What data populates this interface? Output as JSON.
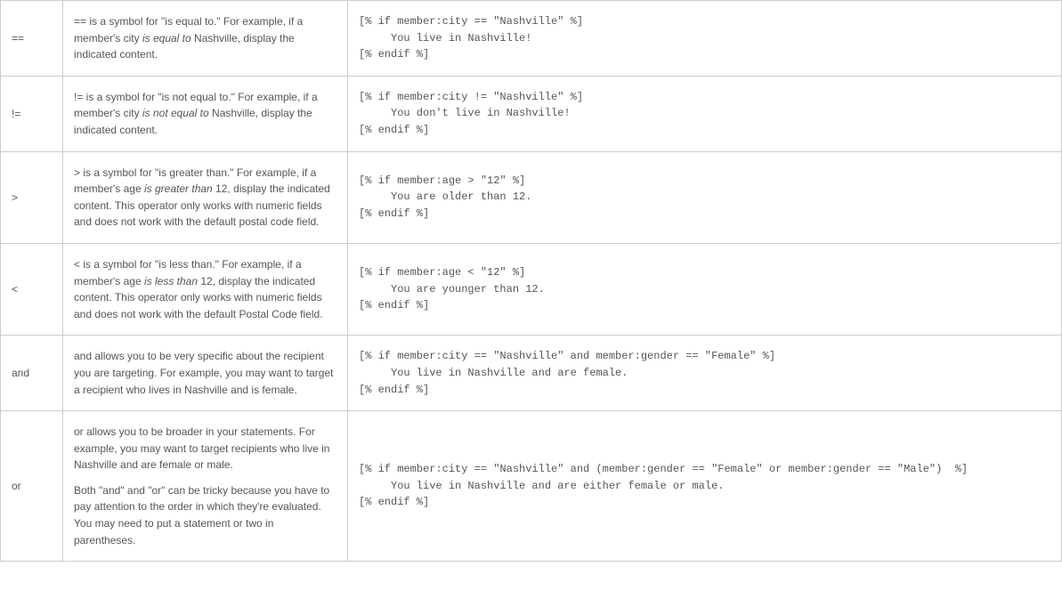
{
  "rows": [
    {
      "operator": "==",
      "desc_html": "== is a symbol for \"is equal to.\" For example, if a member's city <span class=\"italic\">is equal to</span> Nashville, display the indicated content.",
      "code": "[% if member:city == \"Nashville\" %]\n     You live in Nashville!\n[% endif %]"
    },
    {
      "operator": "!=",
      "desc_html": "!= is a symbol for \"is not equal to.\" For example, if a member's city <span class=\"italic\">is not equal to</span> Nashville, display the indicated content.",
      "code": "[% if member:city != \"Nashville\" %]\n     You don't live in Nashville!\n[% endif %]"
    },
    {
      "operator": ">",
      "desc_html": "> is a symbol for \"is greater than.\" For example, if a member's age <span class=\"italic\">is greater than</span> 12, display the indicated content. This operator only works with numeric fields and does not work with the default postal code field.",
      "code": "[% if member:age > \"12\" %]\n     You are older than 12.\n[% endif %]"
    },
    {
      "operator": "<",
      "desc_html": "< is a symbol for \"is less than.\" For example, if a member's age <span class=\"italic\">is less than</span> 12, display the indicated content. This operator only works with numeric fields and does not work with the default Postal Code field.",
      "code": "[% if member:age < \"12\" %]\n     You are younger than 12.\n[% endif %]"
    },
    {
      "operator": "and",
      "desc_html": "and allows you to be very specific about the recipient you are targeting. For example, you may want to target a recipient who lives in Nashville and is female.",
      "code": "[% if member:city == \"Nashville\" and member:gender == \"Female\" %]\n     You live in Nashville and are female.\n[% endif %]"
    },
    {
      "operator": "or",
      "desc_html": "<p>or allows you to be broader in your statements. For example, you may want to target recipients who live in Nashville and are female or male.</p><p>Both \"and\" and \"or\" can be tricky because you have to pay attention to the order in which they're evaluated. You may need to put a statement or two in parentheses.</p>",
      "code": "[% if member:city == \"Nashville\" and (member:gender == \"Female\" or member:gender == \"Male\")  %]\n     You live in Nashville and are either female or male.\n[% endif %]"
    }
  ]
}
